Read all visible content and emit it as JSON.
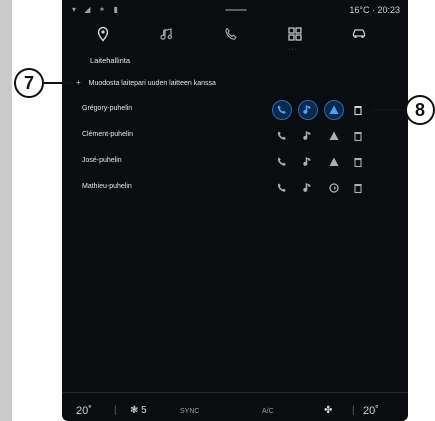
{
  "status": {
    "left_icons": "▾ ◢ ✶ ▮",
    "temperature": "16°C",
    "separator": "·",
    "time": "20:23"
  },
  "tabs": [
    "navigation",
    "media",
    "phone",
    "apps",
    "vehicle"
  ],
  "section_title": "Laitehallinta",
  "pair_new": {
    "icon": "+",
    "label": "Muodosta laitepari uuden laitteen kanssa"
  },
  "devices": [
    {
      "name": "Grégory-puhelin"
    },
    {
      "name": "Clément-puhelin"
    },
    {
      "name": "José-puhelin"
    },
    {
      "name": "Mathieu-puhelin"
    }
  ],
  "callouts": {
    "seven": "7",
    "eight": "8"
  },
  "bottom_bar": {
    "temp_left": "20˚",
    "sep": "|",
    "fan_level": "❃ 5",
    "sync": "SYNC",
    "ac": "A/C",
    "seat": "✤",
    "temp_right": "20˚"
  },
  "colors": {
    "accent": "#1e6cbd",
    "background": "#0a0c10",
    "text": "#e6e8eb"
  }
}
